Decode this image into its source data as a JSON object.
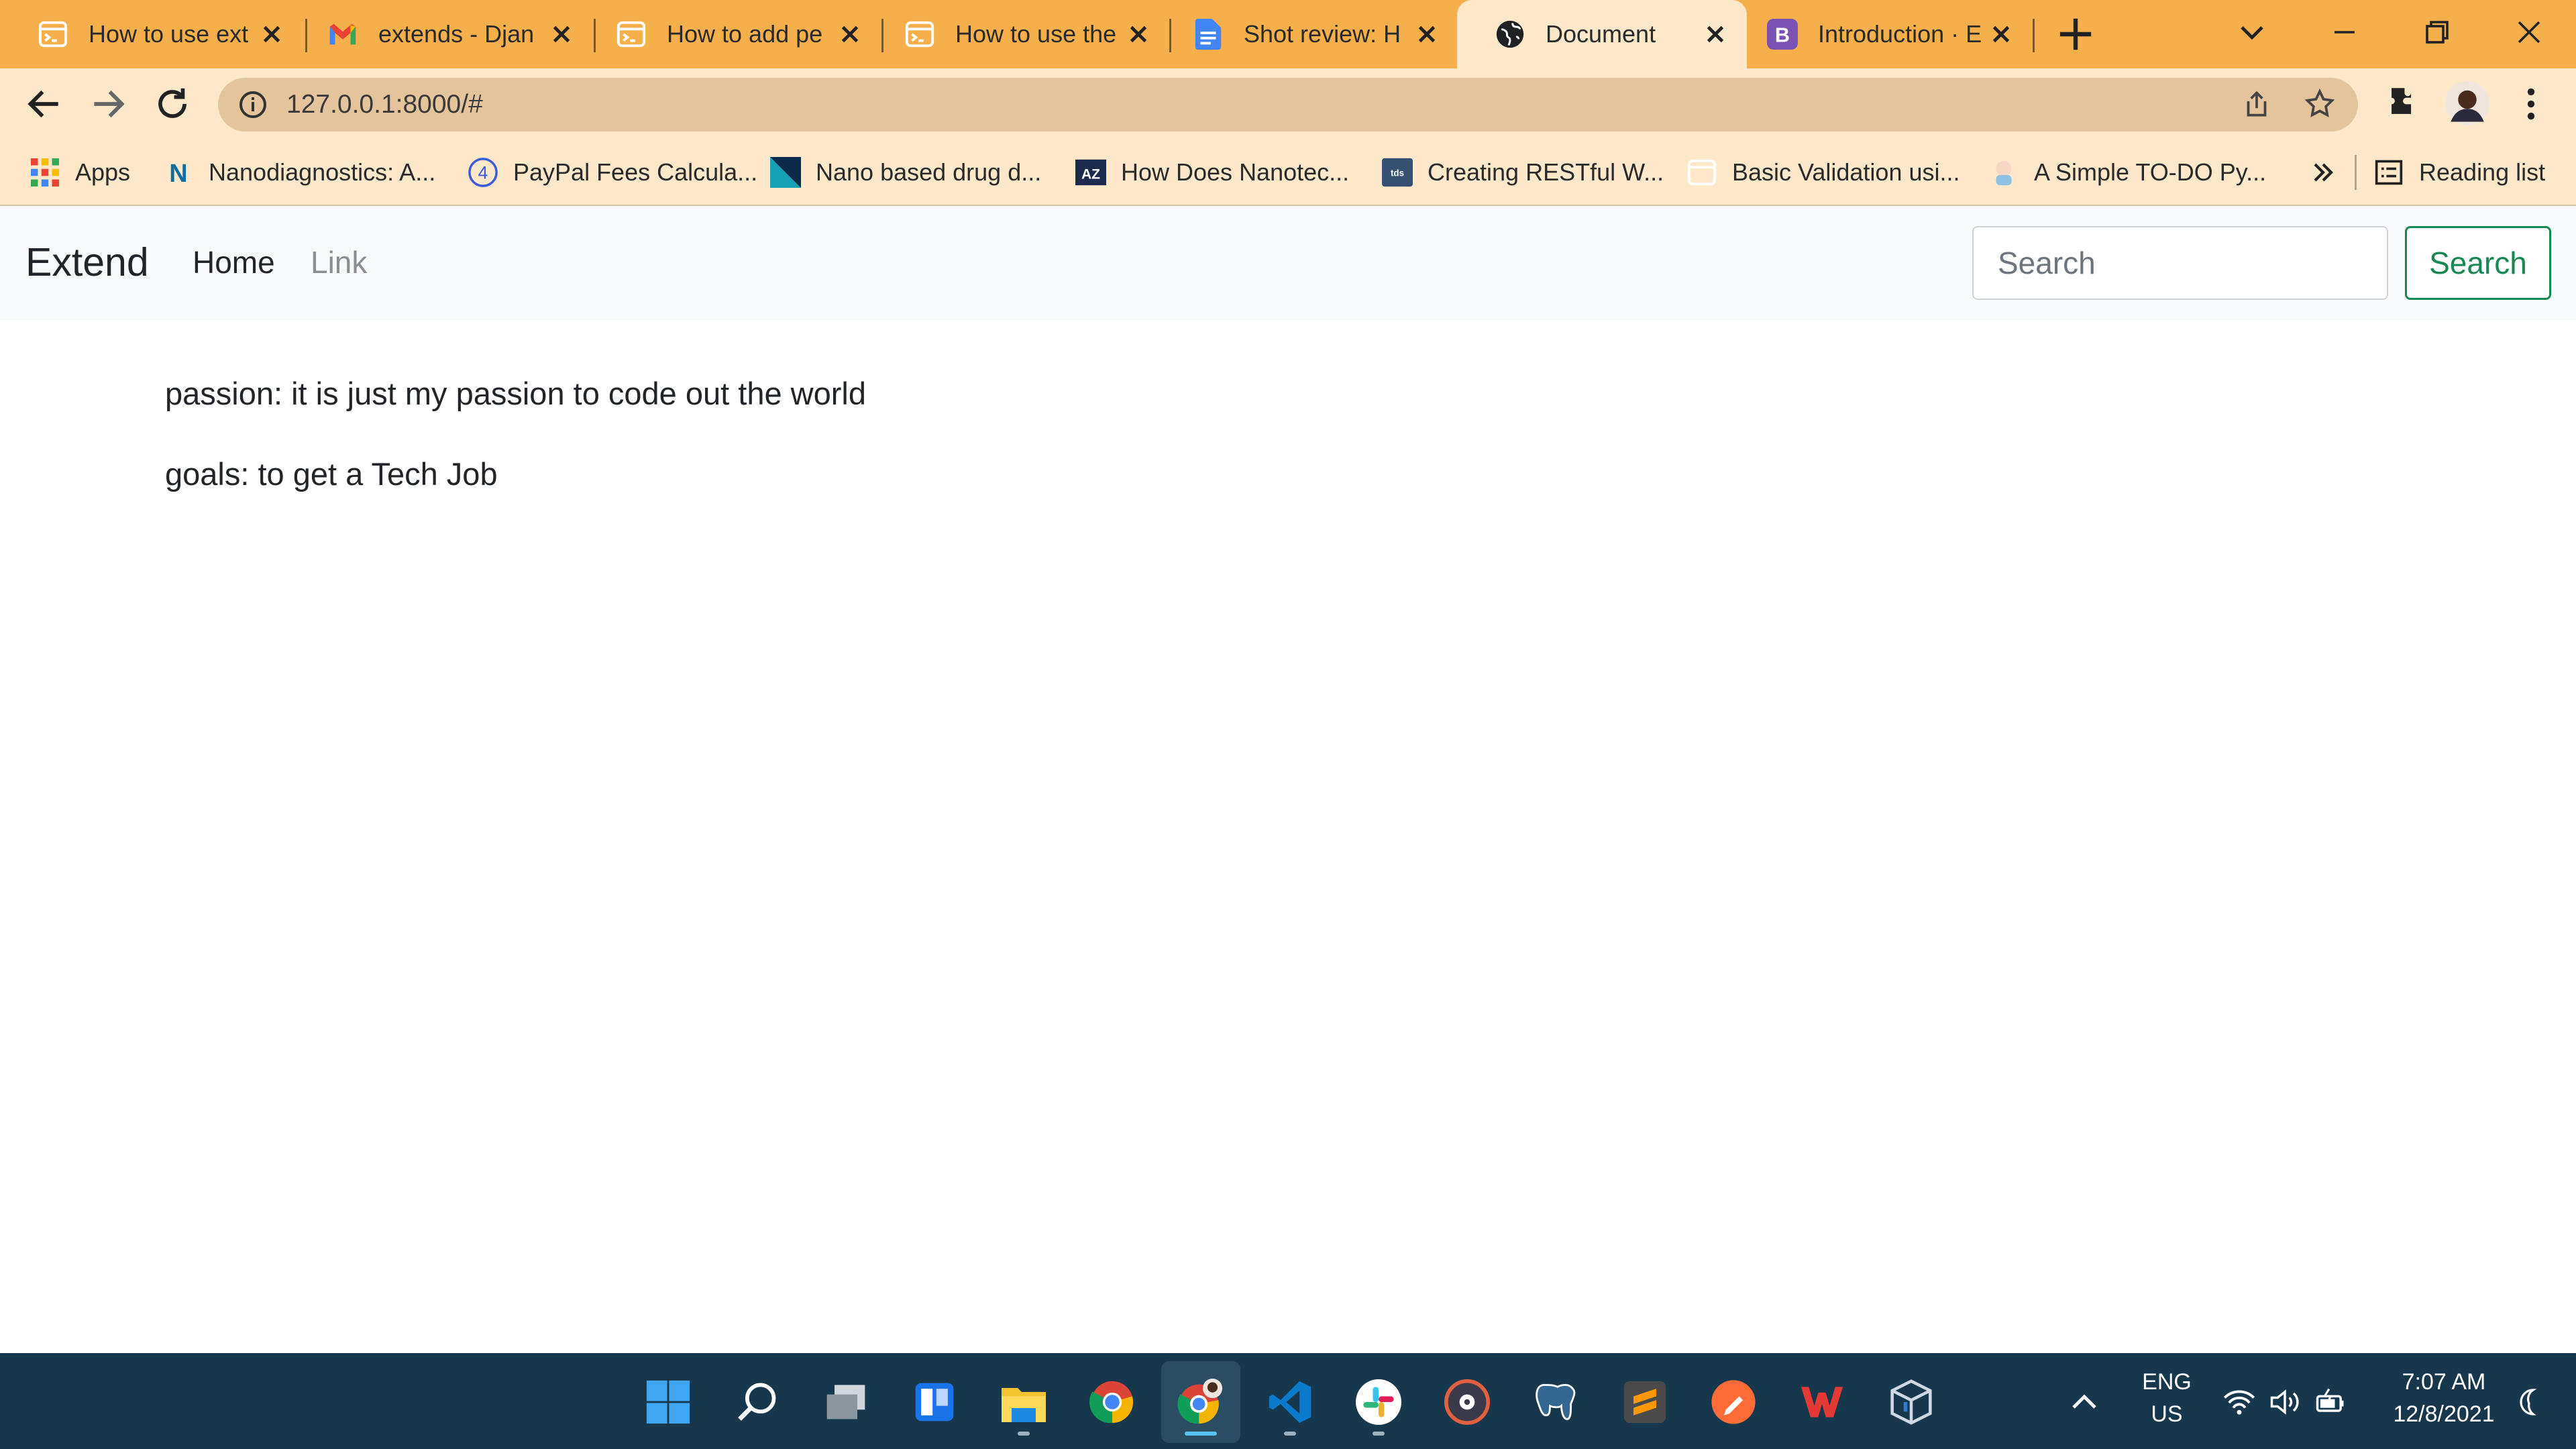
{
  "tabs": [
    {
      "title": "How to use ext",
      "icon": "terminal-page-icon"
    },
    {
      "title": "extends - Djan",
      "icon": "gmail-icon"
    },
    {
      "title": "How to add pe",
      "icon": "terminal-page-icon"
    },
    {
      "title": "How to use the",
      "icon": "terminal-page-icon"
    },
    {
      "title": "Shot review: H",
      "icon": "google-docs-icon"
    },
    {
      "title": "Document",
      "icon": "globe-icon",
      "active": true
    },
    {
      "title": "Introduction · E",
      "icon": "bootstrap-icon"
    }
  ],
  "address_bar": {
    "url": "127.0.0.1:8000/#"
  },
  "bookmarks": {
    "apps_label": "Apps",
    "items": [
      {
        "label": "Nanodiagnostics: A...",
        "icon": "n-logo-icon"
      },
      {
        "label": "PayPal Fees Calcula...",
        "icon": "number-four-icon"
      },
      {
        "label": "Nano based drug d...",
        "icon": "triangle-logo-icon"
      },
      {
        "label": "How Does Nanotec...",
        "icon": "az-logo-icon"
      },
      {
        "label": "Creating RESTful W...",
        "icon": "tds-logo-icon"
      },
      {
        "label": "Basic Validation usi...",
        "icon": "page-icon"
      },
      {
        "label": "A Simple TO-DO Py...",
        "icon": "cartoon-icon"
      }
    ],
    "reading_list_label": "Reading list"
  },
  "page": {
    "navbar": {
      "brand": "Extend",
      "links": [
        "Home",
        "Link"
      ],
      "search_placeholder": "Search",
      "search_button": "Search"
    },
    "content": [
      "passion: it is just my passion to code out the world",
      "goals: to get a Tech Job"
    ]
  },
  "taskbar": {
    "language": "ENG",
    "region": "US",
    "time": "7:07 AM",
    "date": "12/8/2021"
  },
  "colors": {
    "tab_strip": "#f5b04b",
    "toolbar": "#fde8c9",
    "taskbar": "#17374c",
    "success": "#198754"
  }
}
